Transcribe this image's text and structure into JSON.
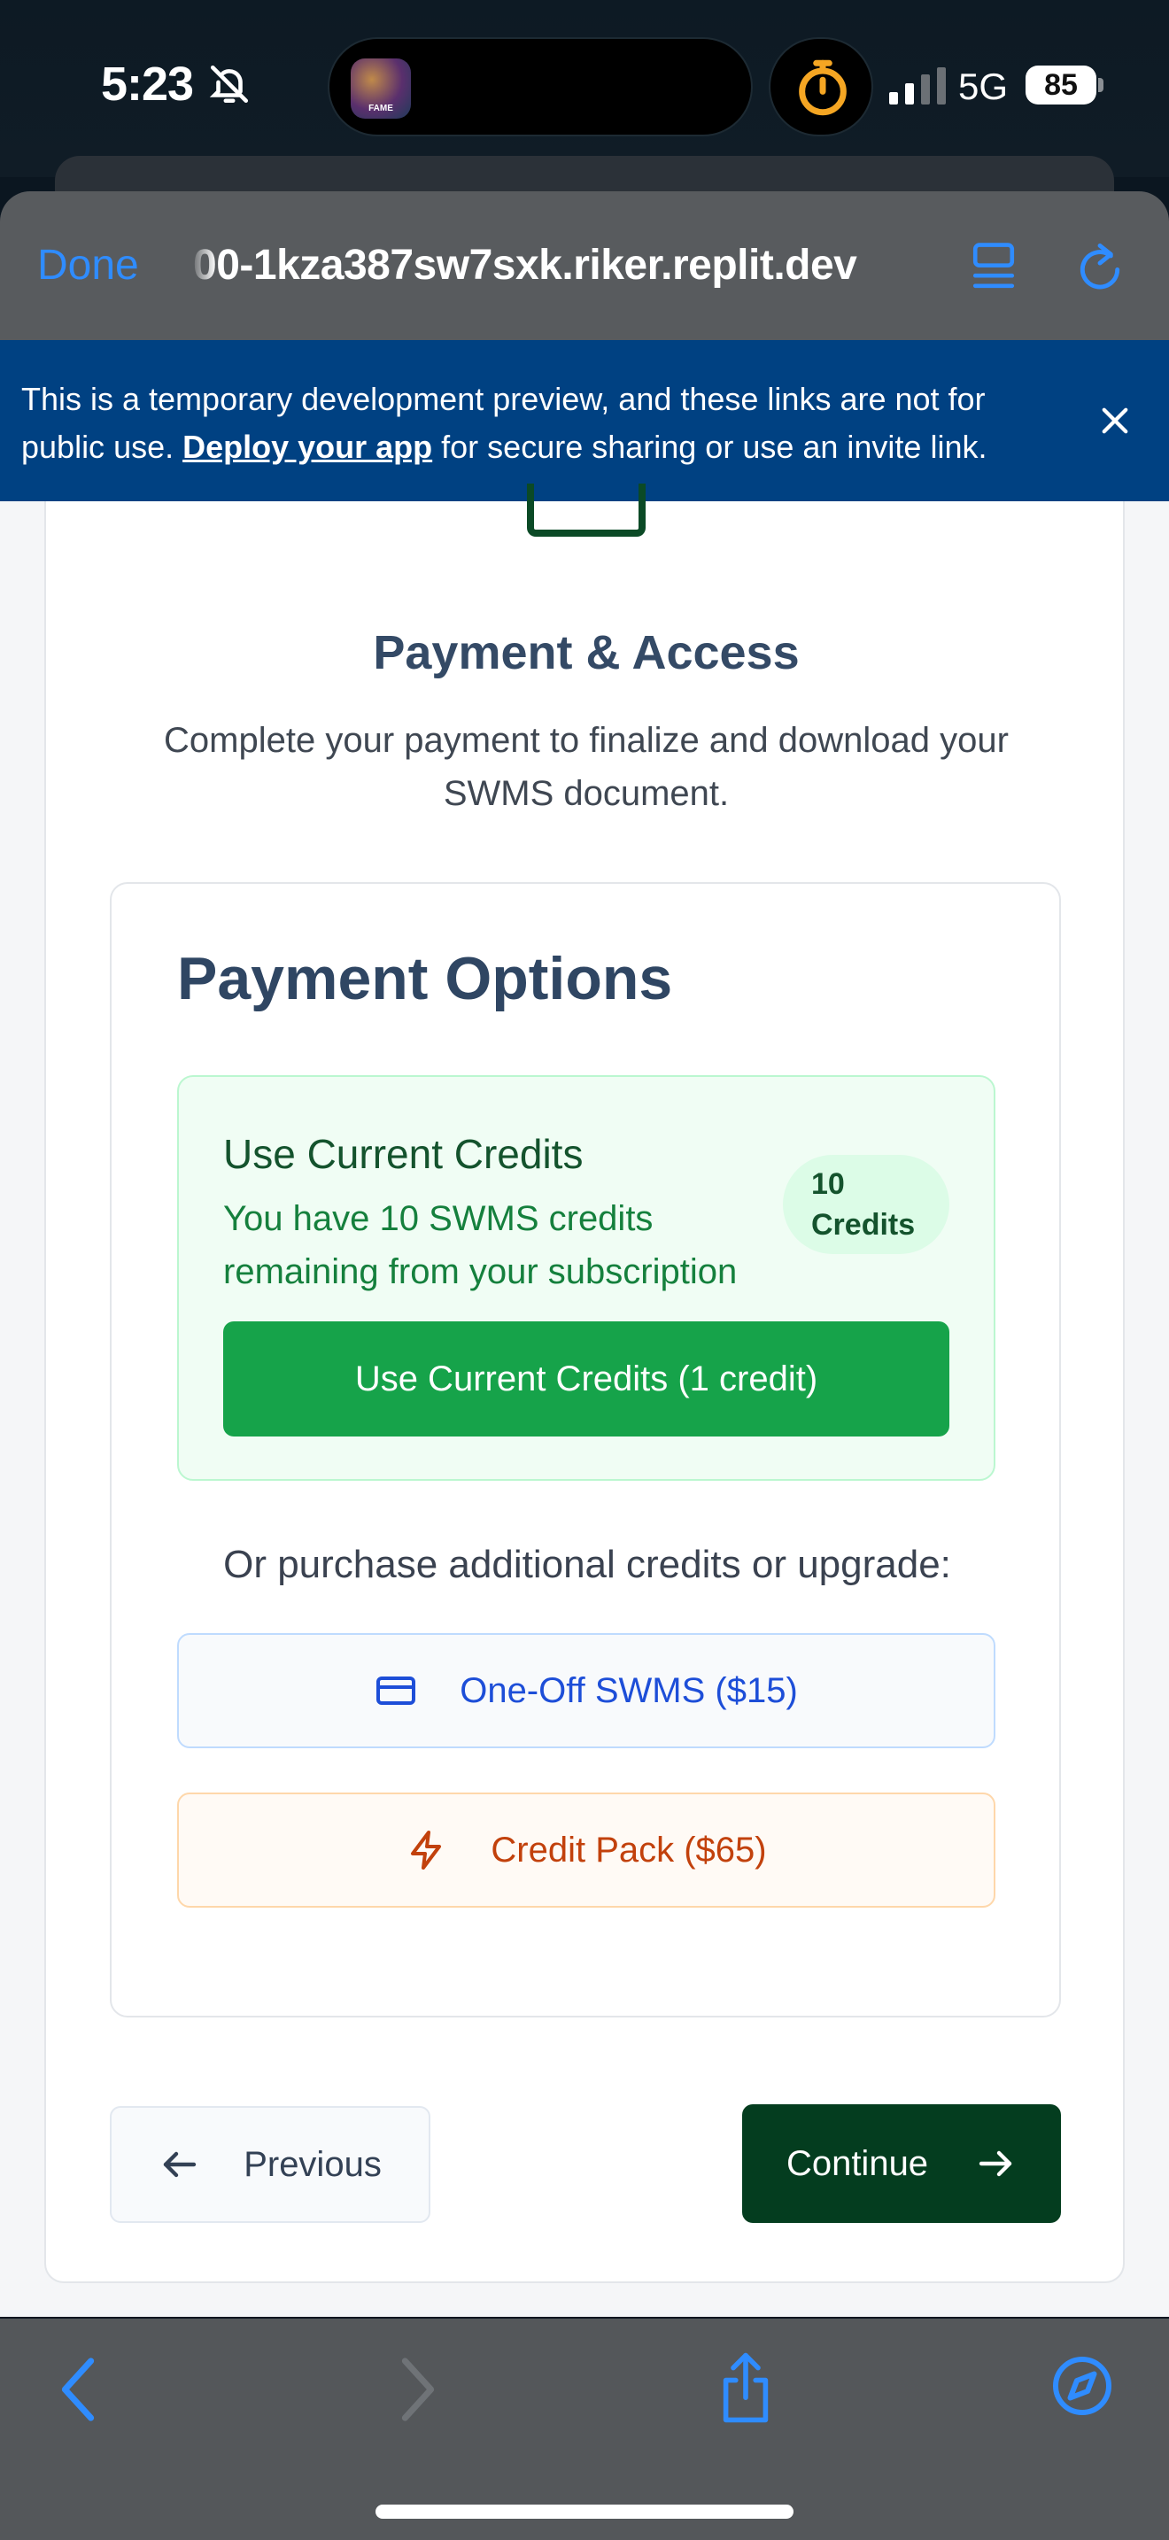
{
  "status_bar": {
    "time": "5:23",
    "network": "5G",
    "battery": "85",
    "island_app_label": "FAME"
  },
  "browser": {
    "done_label": "Done",
    "url": "00-1kza387sw7sxk.riker.replit.dev"
  },
  "banner": {
    "text_before": "This is a temporary development preview, and these links are not for public use. ",
    "link_text": "Deploy your app",
    "text_after": " for secure sharing or use an invite link."
  },
  "page": {
    "title": "Payment & Access",
    "subtitle": "Complete your payment to finalize and download your SWMS document."
  },
  "payment_options": {
    "title": "Payment Options",
    "credits": {
      "title": "Use Current Credits",
      "description": "You have 10 SWMS credits remaining from your subscription",
      "badge_count": "10",
      "badge_unit": "Credits",
      "button_label": "Use Current Credits (1 credit)"
    },
    "purchase_prompt": "Or purchase additional credits or upgrade:",
    "one_off_label": "One-Off SWMS ($15)",
    "credit_pack_label": "Credit Pack ($65)"
  },
  "navigation": {
    "previous_label": "Previous",
    "continue_label": "Continue"
  },
  "colors": {
    "accent_blue": "#2f8cff",
    "banner_blue": "#004182",
    "credits_green": "#16a34a",
    "continue_dark_green": "#043d1f",
    "one_off_blue": "#1d4ed8",
    "credit_pack_orange": "#c2410c"
  },
  "icons": {
    "status": [
      "bell-slash-icon",
      "timer-icon",
      "signal-icon"
    ],
    "browser": [
      "reader-icon",
      "reload-icon",
      "close-icon"
    ],
    "toolbar": [
      "back-icon",
      "forward-icon",
      "share-icon",
      "compass-icon"
    ],
    "buttons": [
      "credit-card-icon",
      "lightning-icon",
      "arrow-left-icon",
      "arrow-right-icon"
    ]
  }
}
